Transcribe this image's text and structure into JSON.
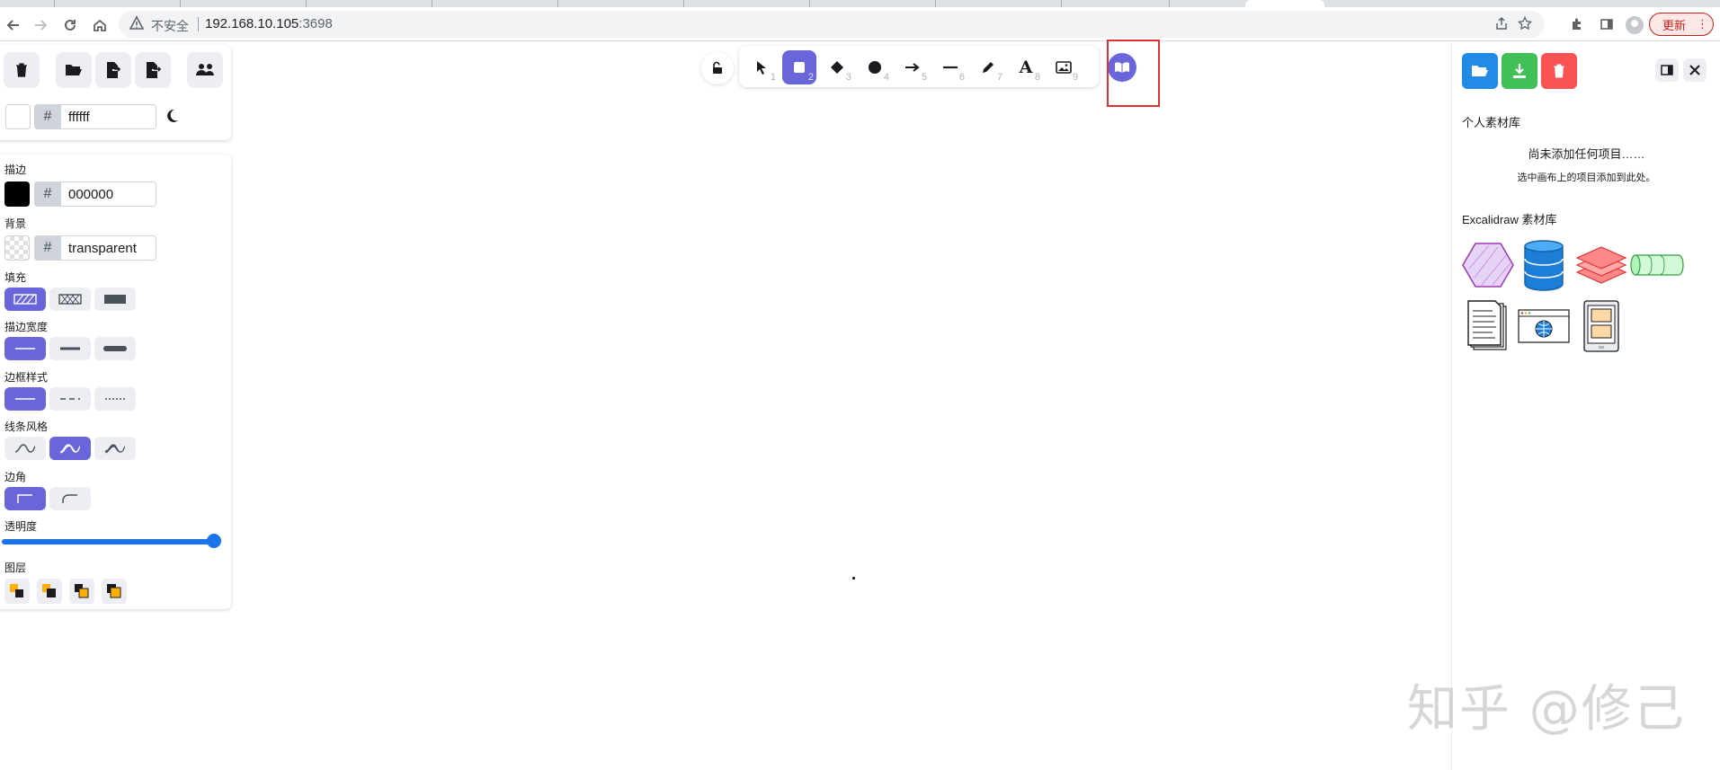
{
  "browser": {
    "insecure_label": "不安全",
    "url_host": "192.168.10.105",
    "url_port": ":3698",
    "update_label": "更新",
    "menu_glyph": "⋮"
  },
  "left_toolbar": {
    "background_hex": "ffffff",
    "hash": "#"
  },
  "properties": {
    "stroke": {
      "label": "描边",
      "hex": "000000",
      "hash": "#"
    },
    "background": {
      "label": "背景",
      "hex": "transparent",
      "hash": "#"
    },
    "fill": {
      "label": "填充"
    },
    "stroke_width": {
      "label": "描边宽度"
    },
    "stroke_style": {
      "label": "边框样式"
    },
    "sloppiness": {
      "label": "线条风格"
    },
    "edges": {
      "label": "边角"
    },
    "opacity": {
      "label": "透明度",
      "value": 100
    },
    "layers": {
      "label": "图层"
    }
  },
  "tools": [
    {
      "name": "selection",
      "num": "1"
    },
    {
      "name": "rectangle",
      "num": "2"
    },
    {
      "name": "diamond",
      "num": "3"
    },
    {
      "name": "ellipse",
      "num": "4"
    },
    {
      "name": "arrow",
      "num": "5"
    },
    {
      "name": "line",
      "num": "6"
    },
    {
      "name": "draw",
      "num": "7"
    },
    {
      "name": "text",
      "num": "8",
      "glyph": "A"
    },
    {
      "name": "image",
      "num": "9"
    }
  ],
  "library": {
    "personal_heading": "个人素材库",
    "empty_title": "尚未添加任何项目……",
    "empty_hint": "选中画布上的项目添加到此处。",
    "excalidraw_heading": "Excalidraw 素材库"
  },
  "watermark": "知乎 @修己",
  "colors": {
    "accent": "#6965db",
    "open_button": "#228be6",
    "export_button": "#40c057",
    "delete_button": "#fa5252",
    "highlight": "#e03131"
  }
}
